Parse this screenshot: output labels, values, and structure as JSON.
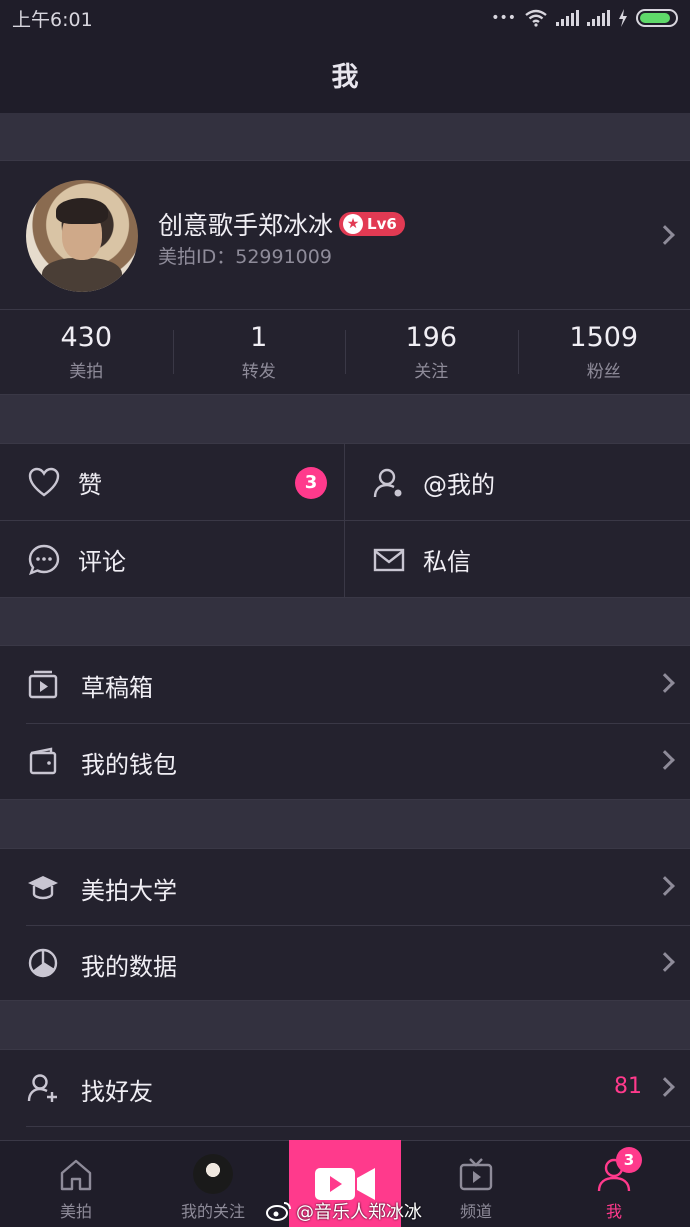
{
  "status": {
    "time": "上午6:01",
    "dots": "•••"
  },
  "header": {
    "title": "我"
  },
  "profile": {
    "name": "创意歌手郑冰冰",
    "level": "Lv6",
    "id_label": "美拍ID：52991009"
  },
  "stats": [
    {
      "value": "430",
      "label": "美拍"
    },
    {
      "value": "1",
      "label": "转发"
    },
    {
      "value": "196",
      "label": "关注"
    },
    {
      "value": "1509",
      "label": "粉丝"
    }
  ],
  "grid": {
    "likes_label": "赞",
    "likes_badge": "3",
    "mentions_label": "@我的",
    "comments_label": "评论",
    "messages_label": "私信"
  },
  "menu1": [
    {
      "label": "草稿箱",
      "icon": "drafts-icon"
    },
    {
      "label": "我的钱包",
      "icon": "wallet-icon"
    }
  ],
  "menu2": [
    {
      "label": "美拍大学",
      "icon": "graduation-cap-icon"
    },
    {
      "label": "我的数据",
      "icon": "pie-chart-icon"
    }
  ],
  "menu3": [
    {
      "label": "找好友",
      "icon": "add-friend-icon",
      "count": "81"
    }
  ],
  "tabs": [
    {
      "label": "美拍"
    },
    {
      "label": "我的关注"
    },
    {
      "label": ""
    },
    {
      "label": "频道"
    },
    {
      "label": "我",
      "badge": "3"
    }
  ],
  "watermark": "@音乐人郑冰冰",
  "colors": {
    "accent": "#ff3a8c",
    "background": "#2a2835",
    "level_badge": "#e23a53"
  }
}
